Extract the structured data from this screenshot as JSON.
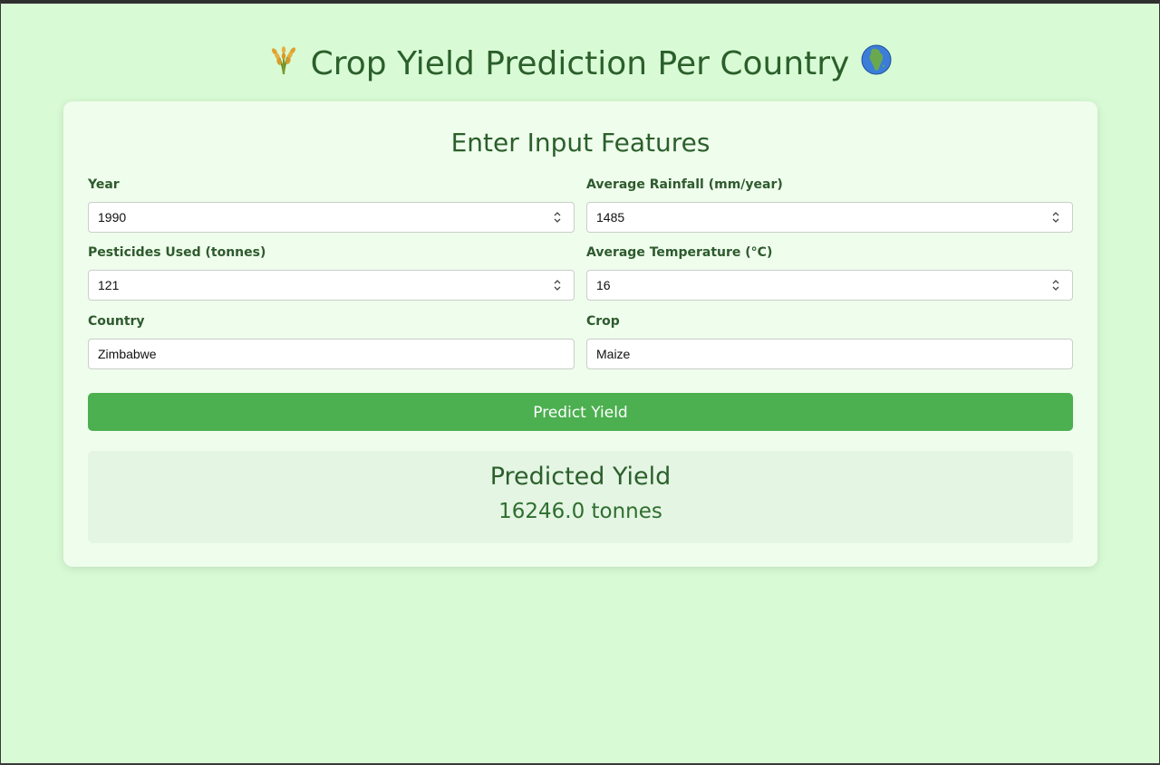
{
  "header": {
    "title": "Crop Yield Prediction Per Country",
    "leading_icon": "rice-plant-icon",
    "trailing_icon": "globe-africa-icon"
  },
  "form": {
    "heading": "Enter Input Features",
    "year": {
      "label": "Year",
      "value": "1990"
    },
    "rainfall": {
      "label": "Average Rainfall (mm/year)",
      "value": "1485"
    },
    "pesticides": {
      "label": "Pesticides Used (tonnes)",
      "value": "121"
    },
    "temperature": {
      "label": "Average Temperature (°C)",
      "value": "16"
    },
    "country": {
      "label": "Country",
      "value": "Zimbabwe"
    },
    "crop": {
      "label": "Crop",
      "value": "Maize"
    },
    "submit_label": "Predict Yield"
  },
  "result": {
    "heading": "Predicted Yield",
    "value": "16246.0 tonnes"
  },
  "colors": {
    "page_background": "#d8fbd5",
    "card_background": "#effdec",
    "accent": "#4caf50",
    "heading_text": "#2b5f2b",
    "result_background": "#e4f5e3"
  }
}
